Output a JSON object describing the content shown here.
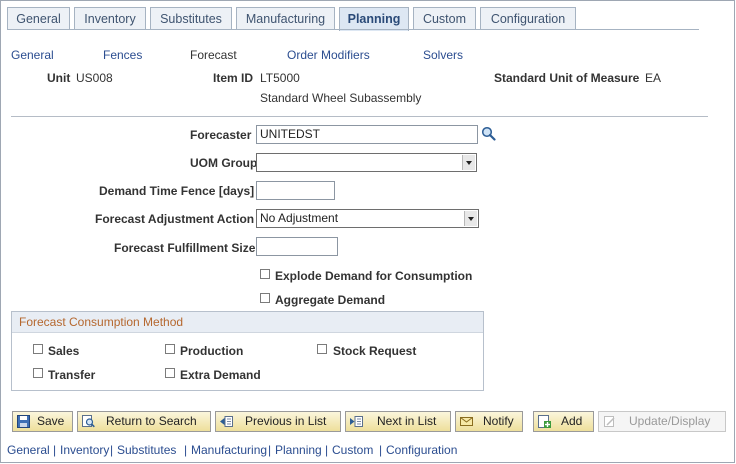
{
  "tabs": [
    {
      "label": "General"
    },
    {
      "label": "Inventory"
    },
    {
      "label": "Substitutes"
    },
    {
      "label": "Manufacturing"
    },
    {
      "label": "Planning"
    },
    {
      "label": "Custom"
    },
    {
      "label": "Configuration"
    }
  ],
  "active_tab": "Planning",
  "sublinks": [
    {
      "label": "General"
    },
    {
      "label": "Fences"
    },
    {
      "label": "Forecast"
    },
    {
      "label": "Order Modifiers"
    },
    {
      "label": "Solvers"
    }
  ],
  "header": {
    "unit_label": "Unit",
    "unit_value": "US008",
    "item_label": "Item ID",
    "item_value": "LT5000",
    "item_desc": "Standard Wheel Subassembly",
    "uom_label": "Standard Unit of Measure",
    "uom_value": "EA"
  },
  "form": {
    "forecaster_label": "Forecaster",
    "forecaster_value": "UNITEDST",
    "uom_group_label": "UOM Group",
    "uom_group_value": "",
    "demand_fence_label": "Demand Time Fence [days]",
    "demand_fence_value": "",
    "adjustment_label": "Forecast Adjustment Action",
    "adjustment_value": "No Adjustment",
    "fulfillment_label": "Forecast Fulfillment Size",
    "fulfillment_value": "",
    "explode_label": "Explode Demand for Consumption",
    "aggregate_label": "Aggregate Demand"
  },
  "consumption": {
    "title": "Forecast Consumption Method",
    "sales": "Sales",
    "production": "Production",
    "stock_request": "Stock Request",
    "transfer": "Transfer",
    "extra_demand": "Extra Demand"
  },
  "toolbar": {
    "save": "Save",
    "return": "Return to Search",
    "previous": "Previous in List",
    "next": "Next in List",
    "notify": "Notify",
    "add": "Add",
    "update": "Update/Display"
  },
  "bottom_links": [
    {
      "label": "General"
    },
    {
      "label": "Inventory"
    },
    {
      "label": "Substitutes"
    },
    {
      "label": "Manufacturing"
    },
    {
      "label": "Planning"
    },
    {
      "label": "Custom"
    },
    {
      "label": "Configuration"
    }
  ],
  "bottom_separator": "|",
  "colors": {
    "link": "#2b4d90",
    "group_title": "#b5672e",
    "button_top": "#fbf6dc",
    "button_bottom": "#eedf9b"
  }
}
